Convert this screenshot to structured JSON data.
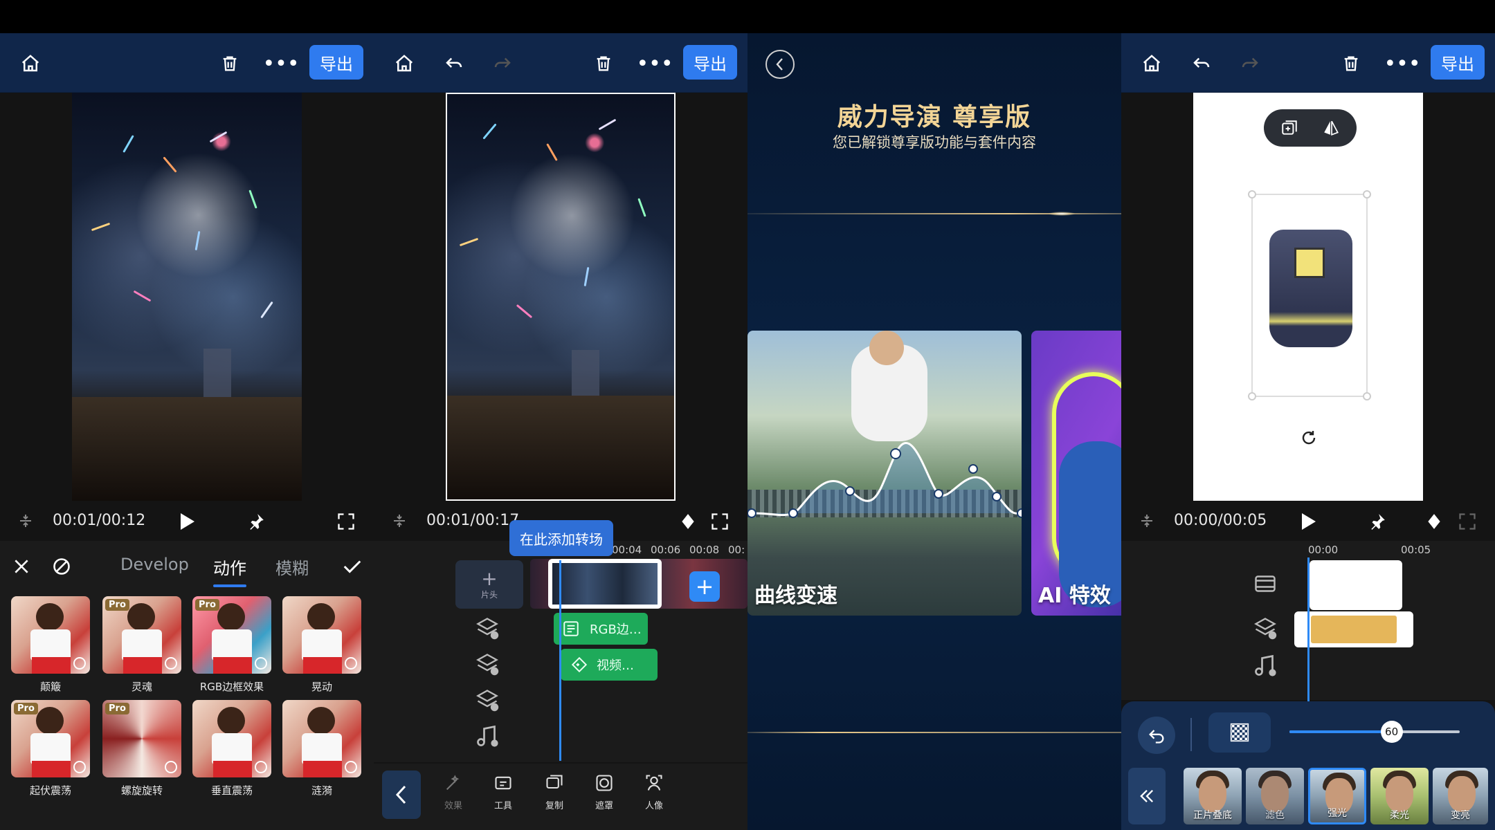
{
  "panel1": {
    "export_label": "导出",
    "timecode": "00:01/00:12",
    "tabs": [
      "Develop",
      "动作",
      "模糊"
    ],
    "effects": [
      {
        "label": "颠簸",
        "pro": false
      },
      {
        "label": "灵魂",
        "pro": true
      },
      {
        "label": "RGB边框效果",
        "pro": true
      },
      {
        "label": "晃动",
        "pro": false
      },
      {
        "label": "起伏震荡",
        "pro": true
      },
      {
        "label": "螺旋旋转",
        "pro": true
      },
      {
        "label": "垂直震荡",
        "pro": false
      },
      {
        "label": "涟漪",
        "pro": false
      }
    ],
    "pro_badge": "Pro"
  },
  "panel2": {
    "export_label": "导出",
    "timecode": "00:01/00:17",
    "transition_tip": "在此添加转场",
    "ruler": [
      "00:04",
      "00:06",
      "00:08",
      "00:"
    ],
    "add_clip_label": "片头",
    "add_clip_plus": "+",
    "add_button_plus": "+",
    "chips": [
      "RGB边…",
      "视频…"
    ],
    "tools": [
      "效果",
      "工具",
      "复制",
      "遮罩",
      "人像"
    ]
  },
  "panel3": {
    "title": "威力导演 尊享版",
    "subtitle": "您已解锁尊享版功能与套件内容",
    "cards": [
      "曲线变速",
      "AI 特效"
    ]
  },
  "panel4": {
    "export_label": "导出",
    "timecode": "00:00/00:05",
    "ruler": [
      "00:00",
      "00:05"
    ],
    "slider_value": 60,
    "blends": [
      {
        "label": "正片叠底",
        "selected": false
      },
      {
        "label": "滤色",
        "selected": false
      },
      {
        "label": "强光",
        "selected": true
      },
      {
        "label": "柔光",
        "selected": false
      },
      {
        "label": "变亮",
        "selected": false
      }
    ]
  }
}
